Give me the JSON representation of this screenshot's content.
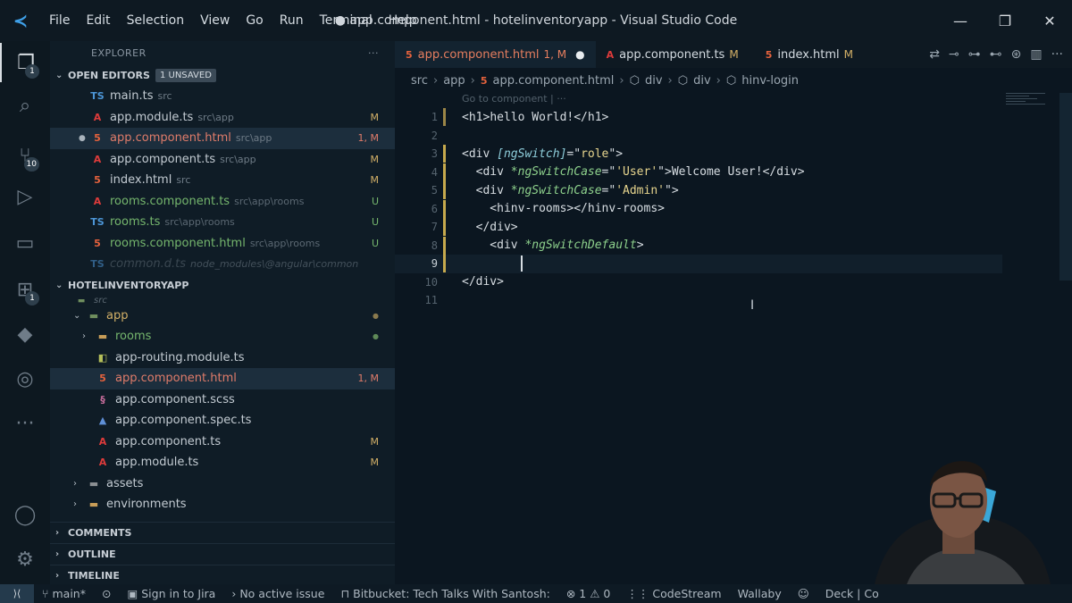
{
  "titlebar": {
    "menu": [
      "File",
      "Edit",
      "Selection",
      "View",
      "Go",
      "Run",
      "Terminal",
      "Help"
    ],
    "window_title": "● app.component.html - hotelinventoryapp - Visual Studio Code"
  },
  "activitybar": {
    "explorer_badge": "1",
    "scm_badge": "10",
    "extensions_badge": "1"
  },
  "sidebar": {
    "title": "EXPLORER",
    "more": "···",
    "open_editors": {
      "header": "OPEN EDITORS",
      "badge": "1 UNSAVED",
      "items": [
        {
          "icon": "TS",
          "name": "main.ts",
          "path": "src",
          "status": ""
        },
        {
          "icon": "A",
          "name": "app.module.ts",
          "path": "src\\app",
          "status": "M"
        },
        {
          "icon": "5",
          "name": "app.component.html",
          "path": "src\\app",
          "status": "1, M"
        },
        {
          "icon": "A",
          "name": "app.component.ts",
          "path": "src\\app",
          "status": "M"
        },
        {
          "icon": "5",
          "name": "index.html",
          "path": "src",
          "status": "M"
        },
        {
          "icon": "A",
          "name": "rooms.component.ts",
          "path": "src\\app\\rooms",
          "status": "U"
        },
        {
          "icon": "TS",
          "name": "rooms.ts",
          "path": "src\\app\\rooms",
          "status": "U"
        },
        {
          "icon": "5",
          "name": "rooms.component.html",
          "path": "src\\app\\rooms",
          "status": "U"
        },
        {
          "icon": "TS",
          "name": "common.d.ts",
          "path": "node_modules\\@angular\\common",
          "status": ""
        }
      ]
    },
    "project": {
      "header": "HOTELINVENTORYAPP",
      "items": [
        {
          "name": "src",
          "status": ""
        },
        {
          "name": "app",
          "status": "●"
        },
        {
          "name": "rooms",
          "status": "●"
        },
        {
          "name": "app-routing.module.ts",
          "status": ""
        },
        {
          "name": "app.component.html",
          "status": "1, M"
        },
        {
          "name": "app.component.scss",
          "status": ""
        },
        {
          "name": "app.component.spec.ts",
          "status": ""
        },
        {
          "name": "app.component.ts",
          "status": "M"
        },
        {
          "name": "app.module.ts",
          "status": "M"
        },
        {
          "name": "assets",
          "status": ""
        },
        {
          "name": "environments",
          "status": ""
        }
      ]
    },
    "bottom_sections": [
      "COMMENTS",
      "OUTLINE",
      "TIMELINE"
    ]
  },
  "editor": {
    "tabs": [
      {
        "icon": "5",
        "label": "app.component.html",
        "mark": "1, M",
        "dirty": "●"
      },
      {
        "icon": "A",
        "label": "app.component.ts",
        "mark": "M",
        "dirty": ""
      },
      {
        "icon": "5",
        "label": "index.html",
        "mark": "M",
        "dirty": ""
      }
    ],
    "breadcrumb": [
      "src",
      "app",
      "app.component.html",
      "div",
      "div",
      "hinv-login"
    ],
    "codelens": "Go to component | ···",
    "line_numbers": [
      "1",
      "2",
      "3",
      "4",
      "5",
      "6",
      "7",
      "8",
      "9",
      "10",
      "11"
    ]
  },
  "statusbar": {
    "branch": "main*",
    "jira": "Sign in to Jira",
    "issue": "No active issue",
    "bitbucket": "Bitbucket: Tech Talks With Santosh:",
    "problems": "⊗ 1 ⚠ 0",
    "codestream": "CodeStream",
    "wallaby": "Wallaby",
    "deck": "Deck | Co"
  },
  "colors": {
    "accent_html": "#e5623d",
    "accent_modified": "#d3b067",
    "accent_untracked": "#75b66d"
  }
}
